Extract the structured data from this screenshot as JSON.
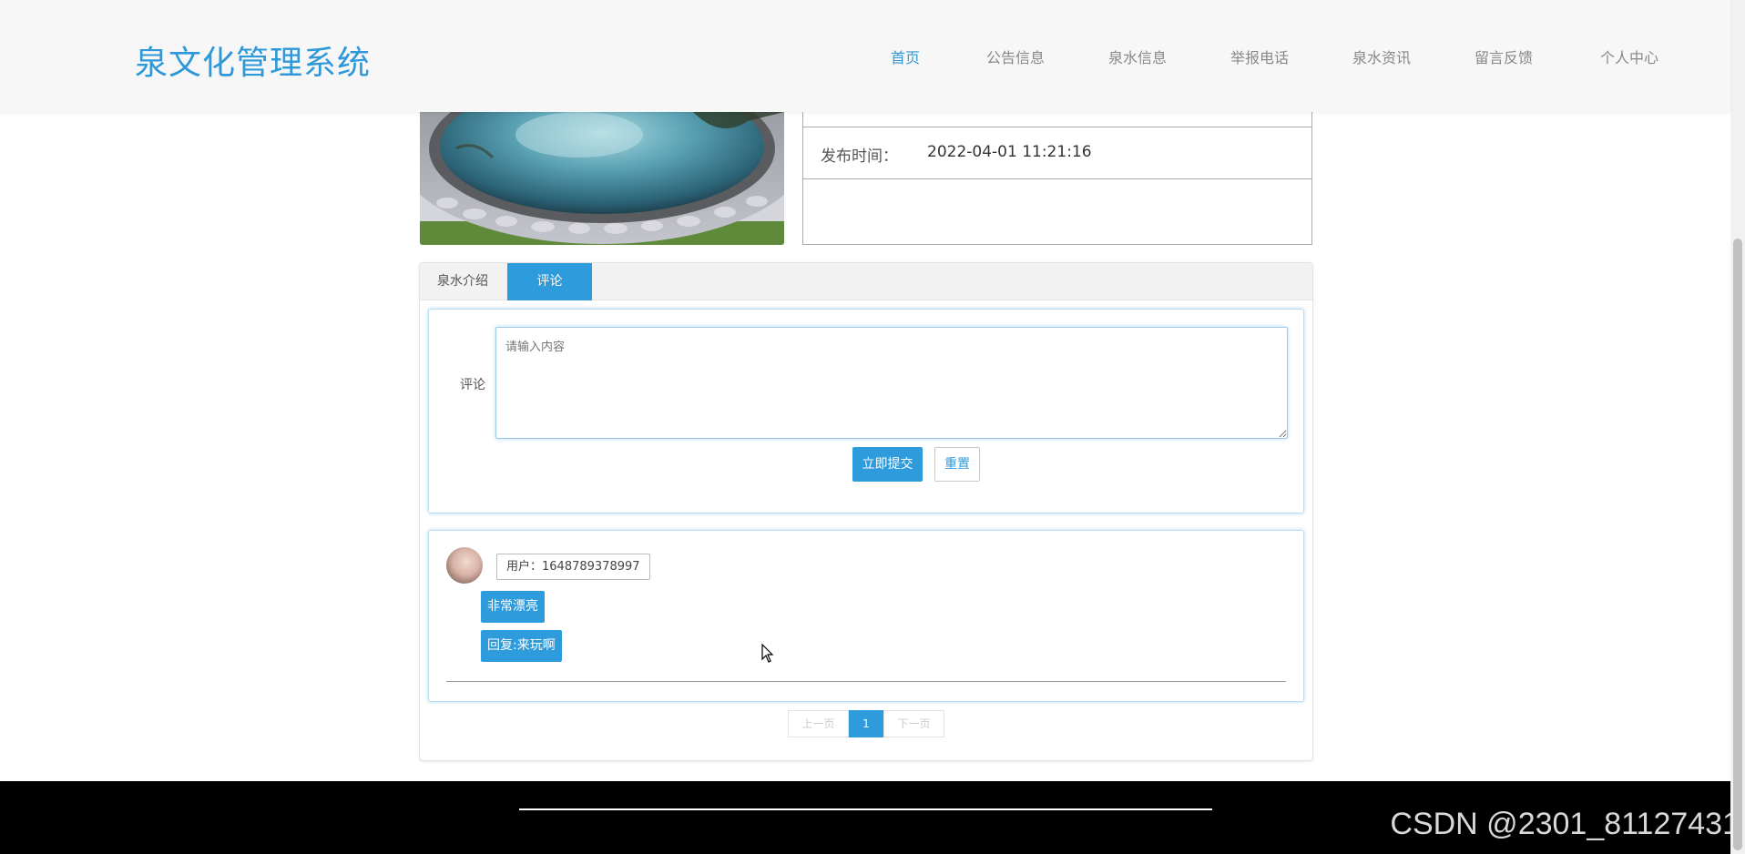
{
  "header": {
    "brand": "泉文化管理系统",
    "nav": [
      {
        "label": "首页",
        "active": true
      },
      {
        "label": "公告信息",
        "active": false
      },
      {
        "label": "泉水信息",
        "active": false
      },
      {
        "label": "举报电话",
        "active": false
      },
      {
        "label": "泉水资讯",
        "active": false
      },
      {
        "label": "留言反馈",
        "active": false
      },
      {
        "label": "个人中心",
        "active": false
      }
    ]
  },
  "detail": {
    "publish_label": "发布时间：",
    "publish_time": "2022-04-01 11:21:16"
  },
  "tabs": [
    {
      "label": "泉水介绍",
      "active": false
    },
    {
      "label": "评论",
      "active": true
    }
  ],
  "comment_form": {
    "label": "评论",
    "placeholder": "请输入内容",
    "submit": "立即提交",
    "reset": "重置"
  },
  "comments": [
    {
      "user": "用户：1648789378997",
      "content": "非常漂亮",
      "reply": "回复:来玩啊"
    }
  ],
  "pagination": {
    "prev": "上一页",
    "current": "1",
    "next": "下一页"
  },
  "footer": {
    "watermark": "CSDN @2301_81127431"
  },
  "colors": {
    "accent": "#2e9bdd",
    "brand": "#2e98d8",
    "footer_bg": "#000000"
  }
}
